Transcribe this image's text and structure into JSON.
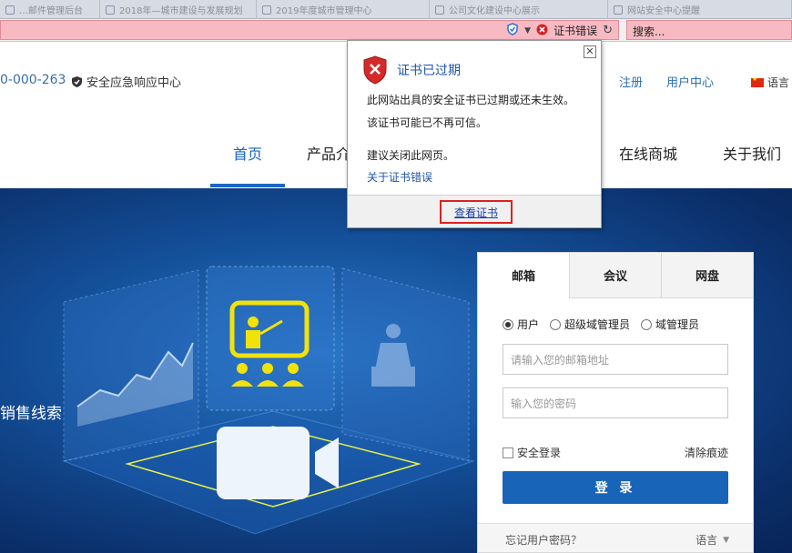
{
  "browser": {
    "tabs": [
      {
        "title": "…邮件管理后台"
      },
      {
        "title": "2018年—城市建设与发展规划"
      },
      {
        "title": "2019年度城市管理中心"
      },
      {
        "title": "公司文化建设中心展示"
      },
      {
        "title": "网站安全中心提醒"
      }
    ],
    "cert_error_label": "证书错误",
    "search_placeholder": "搜索..."
  },
  "site": {
    "hotline": "0-000-263",
    "security_center": "安全应急响应中心",
    "top_links": [
      "注册",
      "用户中心"
    ],
    "language": "语言",
    "nav": [
      "首页",
      "产品介",
      "在线商城",
      "关于我们"
    ],
    "hero_text": "销售线索"
  },
  "login": {
    "tabs": [
      "邮箱",
      "会议",
      "网盘"
    ],
    "roles": [
      "用户",
      "超级域管理员",
      "域管理员"
    ],
    "email_placeholder": "请输入您的邮箱地址",
    "password_placeholder": "输入您的密码",
    "remember": "安全登录",
    "clear": "清除痕迹",
    "submit": "登 录",
    "forgot": "忘记用户密码？",
    "language": "语言"
  },
  "cert_popup": {
    "title": "证书已过期",
    "line1": "此网站出具的安全证书已过期或还未生效。",
    "line2": "该证书可能已不再可信。",
    "line3": "建议关闭此网页。",
    "link": "关于证书错误",
    "view_cert": "查看证书"
  }
}
